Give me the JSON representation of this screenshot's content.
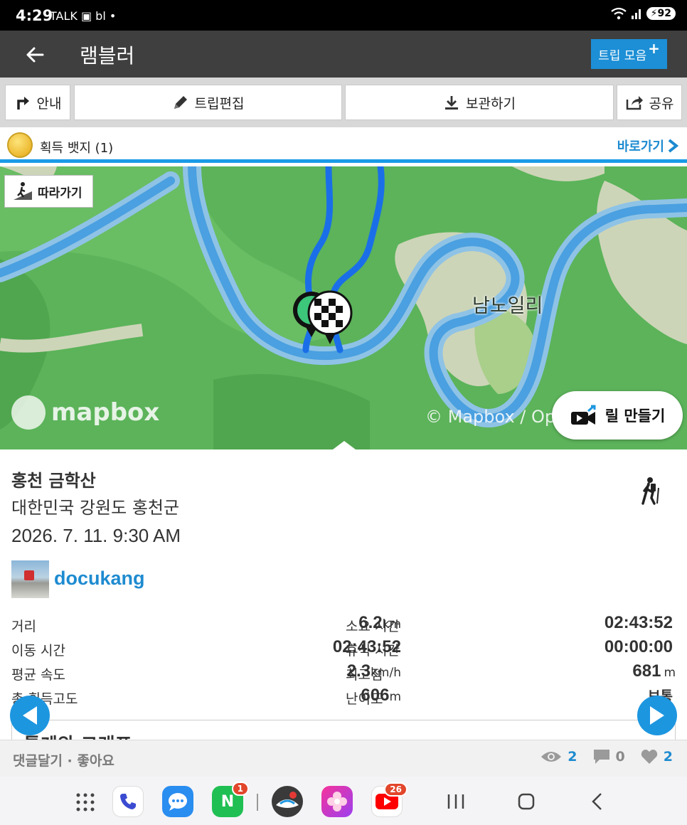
{
  "status_bar": {
    "time": "4:29",
    "app_icons": "TALK ▣ bl •",
    "battery": "92"
  },
  "header": {
    "title": "램블러",
    "trip_collection_label": "트립 모음",
    "trip_collection_plus": "+"
  },
  "toolbar": {
    "guide": "안내",
    "edit": "트립편집",
    "save": "보관하기",
    "share": "공유"
  },
  "badges": {
    "label": "획득 뱃지 (1)",
    "link": "바로가기"
  },
  "map": {
    "follow_label": "따라가기",
    "place_label": "남노일리",
    "logo_text": "mapbox",
    "attribution": "© Mapbox / Op",
    "reel_label": "릴 만들기",
    "colors": {
      "forest": "#5cb35a",
      "river": "#4aa0e0",
      "track": "#1a6fe8"
    }
  },
  "trip": {
    "title": "홍천 금학산",
    "location": "대한민국 강원도 홍천군",
    "datetime": "2026. 7. 11. 9:30 AM",
    "username": "docukang",
    "activity_icon": "hiking-icon"
  },
  "stats": [
    {
      "label": "거리",
      "value": "6.2",
      "unit": "km",
      "label2": "소요 시간",
      "value2": "02:43:52",
      "unit2": ""
    },
    {
      "label": "이동 시간",
      "value": "02:43:52",
      "unit": "",
      "label2": "휴식 시간",
      "value2": "00:00:00",
      "unit2": ""
    },
    {
      "label": "평균 속도",
      "value": "2.3",
      "unit": "km/h",
      "label2": "최고점",
      "value2": "681",
      "unit2": "m"
    },
    {
      "label": "총 획득고도",
      "value": "606",
      "unit": "m",
      "label2": "난이도",
      "value2": "보통",
      "unit2": ""
    }
  ],
  "chart_section": {
    "title": "통계와 그래프"
  },
  "footer": {
    "comment_like": "댓글달기 · 좋아요",
    "views": "2",
    "comments": "0",
    "likes": "2"
  },
  "dock": {
    "npay_badge": "1",
    "youtube_badge": "26",
    "naver_letter": "N"
  },
  "accent": "#1d96e0"
}
